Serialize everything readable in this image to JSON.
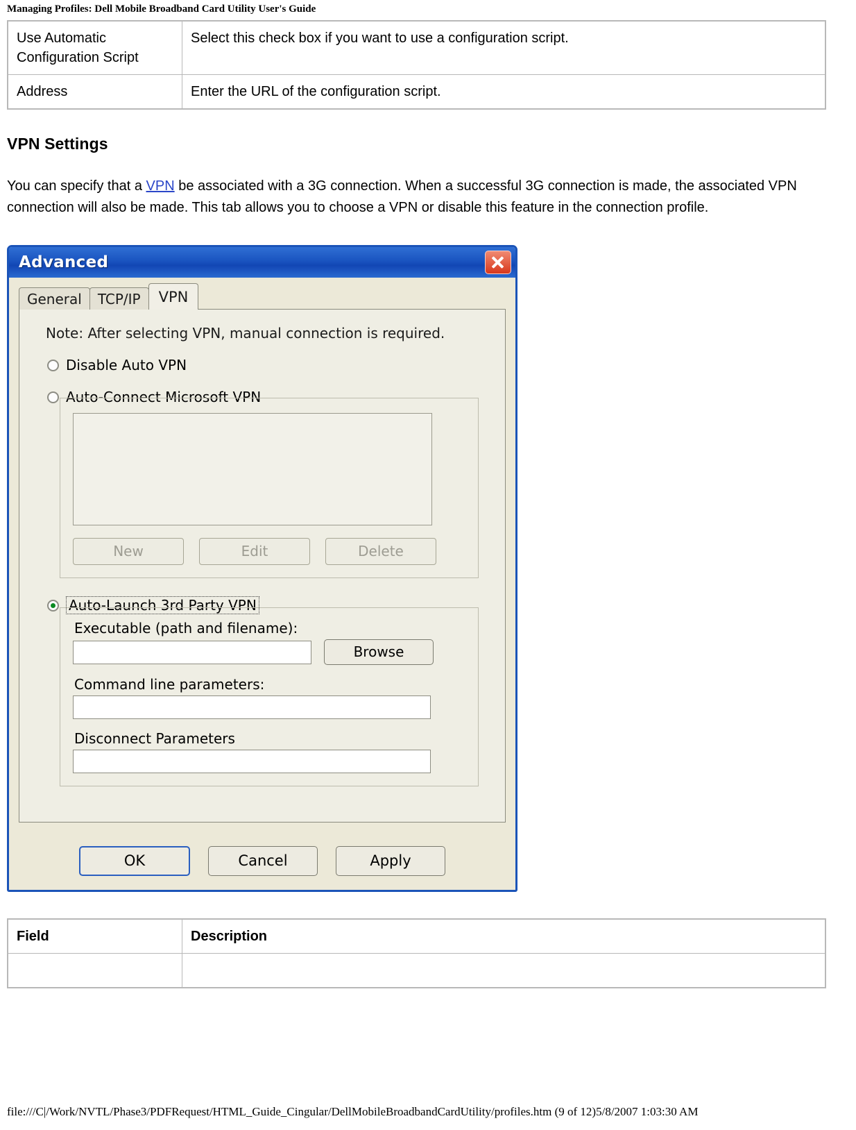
{
  "header": {
    "title": "Managing Profiles: Dell Mobile Broadband Card Utility User's Guide"
  },
  "table_top": {
    "rows": [
      {
        "field": "Use Automatic Configuration Script",
        "description": "Select this check box if you want to use a configuration script."
      },
      {
        "field": "Address",
        "description": "Enter the URL of the configuration script."
      }
    ]
  },
  "section": {
    "heading": "VPN Settings",
    "paragraph_1": "You can specify that a ",
    "link_text": "VPN",
    "paragraph_2": " be associated with a 3G connection. When a successful 3G connection is made, the associated VPN connection will also be made. This tab allows you to choose a VPN or disable this feature in the connection profile."
  },
  "dialog": {
    "title": "Advanced",
    "close_label": "Close",
    "tabs": [
      {
        "label": "General",
        "active": false
      },
      {
        "label": "TCP/IP",
        "active": false
      },
      {
        "label": "VPN",
        "active": true
      }
    ],
    "note": "Note: After selecting VPN, manual connection is required.",
    "radio_disable": "Disable Auto VPN",
    "radio_microsoft": "Auto-Connect Microsoft VPN",
    "buttons": {
      "new": "New",
      "edit": "Edit",
      "delete": "Delete",
      "browse": "Browse"
    },
    "radio_third_party": "Auto-Launch 3rd Party VPN",
    "label_executable": "Executable (path and filename):",
    "label_command_line": "Command line parameters:",
    "label_disconnect": "Disconnect Parameters",
    "value_executable": "",
    "value_command_line": "",
    "value_disconnect": "",
    "footer_buttons": {
      "ok": "OK",
      "cancel": "Cancel",
      "apply": "Apply"
    }
  },
  "table_bottom": {
    "headers": {
      "field": "Field",
      "description": "Description"
    }
  },
  "footer": {
    "path": "file:///C|/Work/NVTL/Phase3/PDFRequest/HTML_Guide_Cingular/DellMobileBroadbandCardUtility/profiles.htm (9 of 12)5/8/2007 1:03:30 AM"
  }
}
